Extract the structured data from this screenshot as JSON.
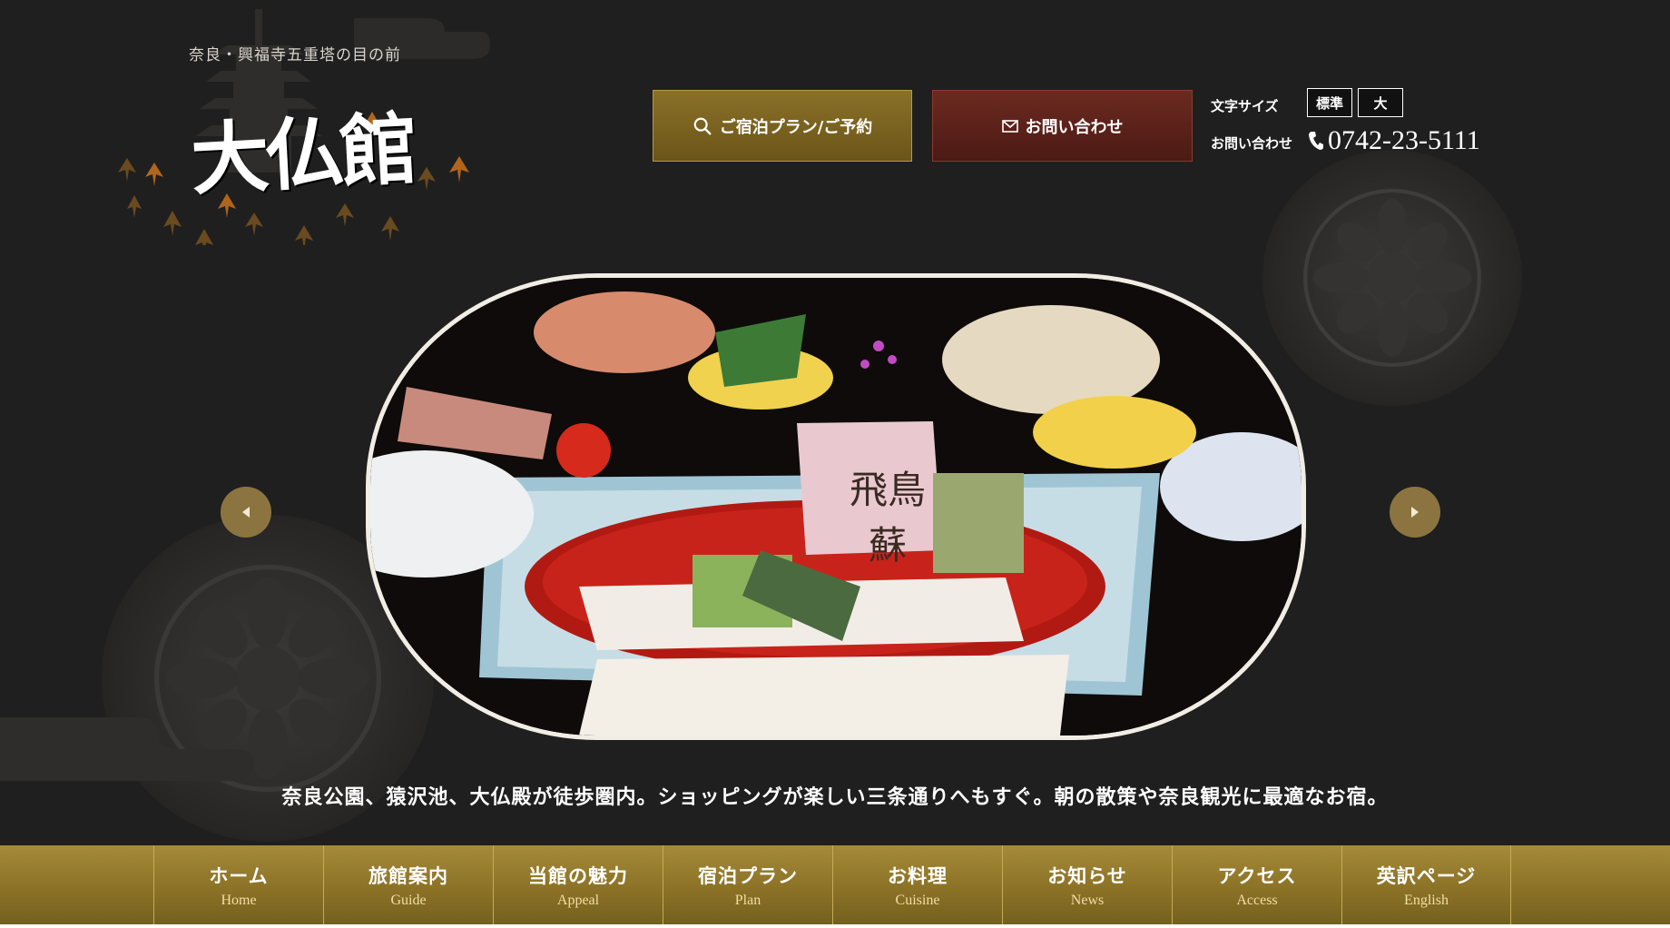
{
  "header": {
    "tagline": "奈良・興福寺五重塔の目の前",
    "logo_text": "大仏館",
    "plan_button": "ご宿泊プラン/ご予約",
    "contact_button": "お問い合わせ",
    "font_size_label": "文字サイズ",
    "font_size_standard": "標準",
    "font_size_large": "大",
    "contact_label": "お問い合わせ",
    "phone": "0742-23-5111"
  },
  "hero": {
    "card_text": "飛鳥 蘇"
  },
  "lead_text": "奈良公園、猿沢池、大仏殿が徒歩圏内。ショッピングが楽しい三条通りへもすぐ。朝の散策や奈良観光に最適なお宿。",
  "nav": [
    {
      "ja": "ホーム",
      "en": "Home"
    },
    {
      "ja": "旅館案内",
      "en": "Guide"
    },
    {
      "ja": "当館の魅力",
      "en": "Appeal"
    },
    {
      "ja": "宿泊プラン",
      "en": "Plan"
    },
    {
      "ja": "お料理",
      "en": "Cuisine"
    },
    {
      "ja": "お知らせ",
      "en": "News"
    },
    {
      "ja": "アクセス",
      "en": "Access"
    },
    {
      "ja": "英訳ページ",
      "en": "English"
    }
  ],
  "colors": {
    "background": "#1f1f1f",
    "gold": "#8a7028",
    "maroon": "#6b2a20",
    "nav_gold": "#8c7226"
  },
  "icons": {
    "search": "search-icon",
    "mail": "mail-icon",
    "phone": "phone-icon",
    "prev": "arrow-left-icon",
    "next": "arrow-right-icon"
  }
}
